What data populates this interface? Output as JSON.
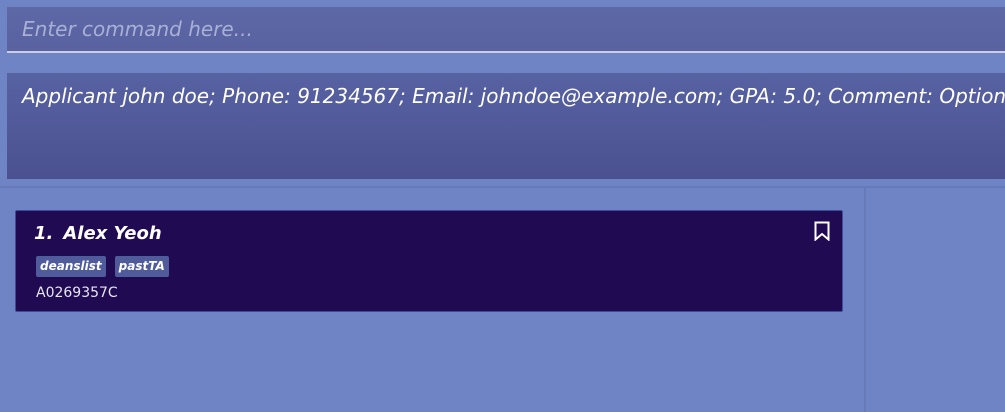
{
  "command": {
    "placeholder": "Enter command here...",
    "value": ""
  },
  "result": {
    "text": "Applicant john doe; Phone: 91234567; Email: johndoe@example.com; GPA: 5.0; Comment: Optional[Hardworking]"
  },
  "applicants": [
    {
      "index": "1.",
      "name": "Alex Yeoh",
      "tags": [
        "deanslist",
        "pastTA"
      ],
      "id": "A0269357C",
      "bookmark_icon": "bookmark-icon"
    }
  ],
  "colors": {
    "background": "#6f84c5",
    "card": "#200a52",
    "tag": "#4f5b9b",
    "result_bg": "#4b5190",
    "command_bg": "#5d68a6"
  }
}
